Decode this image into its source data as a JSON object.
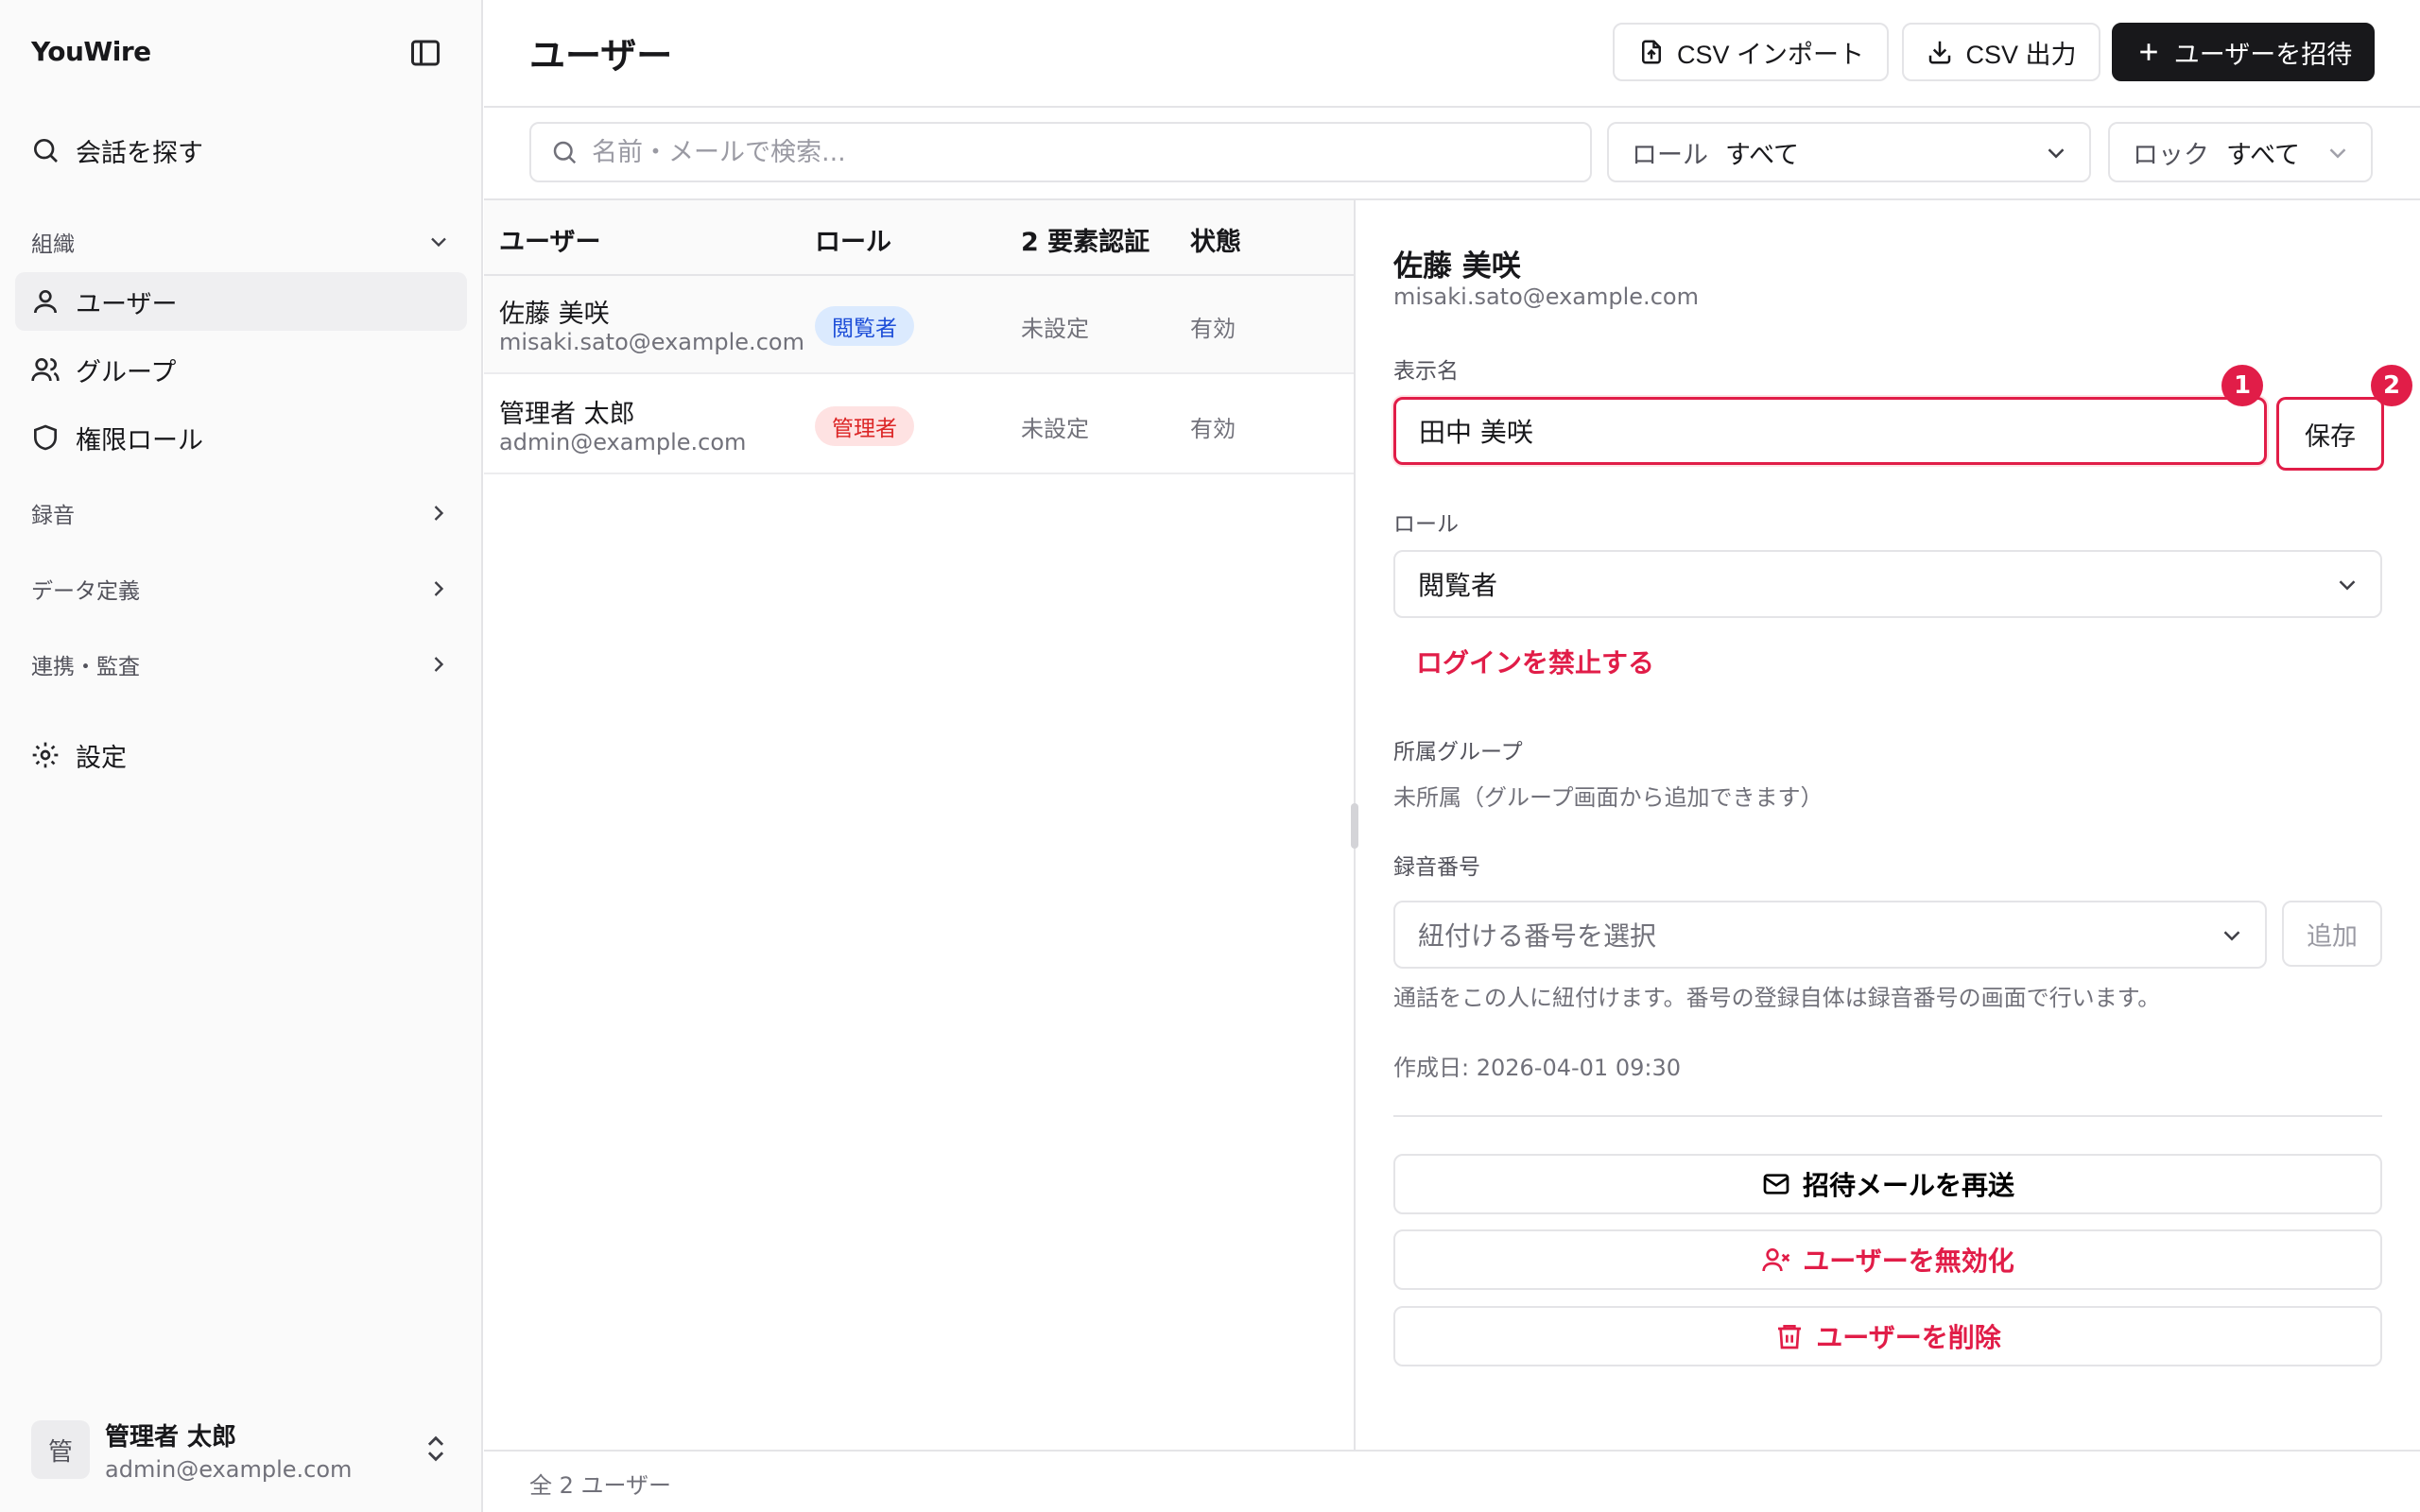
{
  "brand": "YouWire",
  "sidebar": {
    "search_label": "会話を探す",
    "org_group": "組織",
    "items": [
      {
        "label": "ユーザー"
      },
      {
        "label": "グループ"
      },
      {
        "label": "権限ロール"
      }
    ],
    "groups": [
      {
        "label": "録音"
      },
      {
        "label": "データ定義"
      },
      {
        "label": "連携・監査"
      }
    ],
    "settings_label": "設定",
    "user": {
      "avatar": "管",
      "name": "管理者 太郎",
      "email": "admin@example.com"
    }
  },
  "header": {
    "title": "ユーザー",
    "import_label": "CSV インポート",
    "export_label": "CSV 出力",
    "invite_label": "ユーザーを招待"
  },
  "filters": {
    "search_placeholder": "名前・メールで検索...",
    "role_label": "ロール",
    "role_value": "すべて",
    "lock_label": "ロック",
    "lock_value": "すべて"
  },
  "table": {
    "columns": [
      "ユーザー",
      "ロール",
      "2 要素認証",
      "状態"
    ],
    "rows": [
      {
        "name": "佐藤 美咲",
        "email": "misaki.sato@example.com",
        "role": "閲覧者",
        "tfa": "未設定",
        "status": "有効"
      },
      {
        "name": "管理者 太郎",
        "email": "admin@example.com",
        "role": "管理者",
        "tfa": "未設定",
        "status": "有効"
      }
    ],
    "footer": "全 2 ユーザー"
  },
  "detail": {
    "name": "佐藤 美咲",
    "email": "misaki.sato@example.com",
    "display_name_label": "表示名",
    "display_name_value": "田中 美咲",
    "save_label": "保存",
    "role_label": "ロール",
    "role_value": "閲覧者",
    "ban_label": "ログインを禁止する",
    "groups_label": "所属グループ",
    "groups_value": "未所属（グループ画面から追加できます）",
    "phone_label": "録音番号",
    "phone_placeholder": "紐付ける番号を選択",
    "add_label": "追加",
    "phone_help": "通話をこの人に紐付けます。番号の登録自体は録音番号の画面で行います。",
    "created": "作成日: 2026-04-01 09:30",
    "resend_label": "招待メールを再送",
    "disable_label": "ユーザーを無効化",
    "delete_label": "ユーザーを削除"
  },
  "markers": [
    "1",
    "2"
  ],
  "colors": {
    "accent": "#e11d48",
    "primary": "#18181b",
    "viewer_badge": "#dbeafe",
    "admin_badge": "#fee2e2"
  }
}
